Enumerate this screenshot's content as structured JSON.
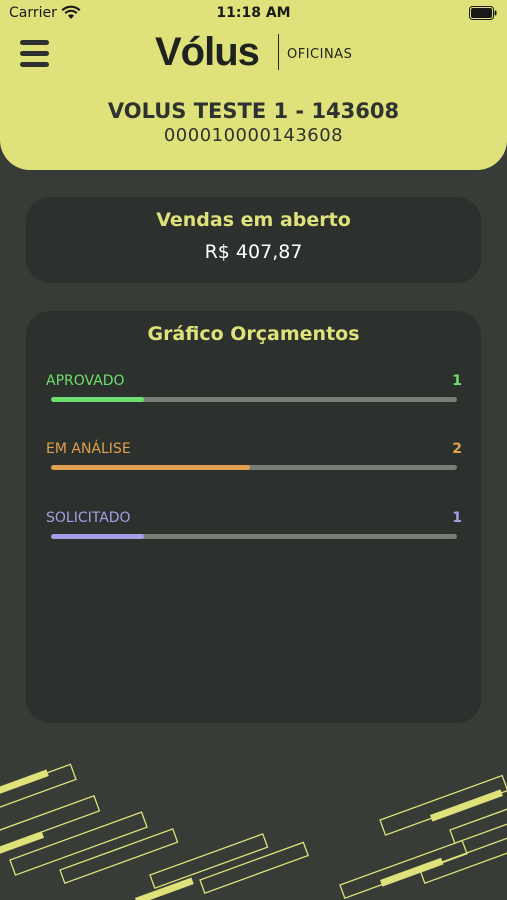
{
  "status_bar": {
    "carrier": "Carrier",
    "time": "11:18 AM"
  },
  "header": {
    "logo_text": "Vólus",
    "logo_subtext": "OFICINAS",
    "account_name": "VOLUS TESTE 1 - 143608",
    "account_number": "000010000143608"
  },
  "sales": {
    "title": "Vendas em aberto",
    "value": "R$ 407,87"
  },
  "chart": {
    "title": "Gráfico Orçamentos",
    "rows": [
      {
        "label": "APROVADO",
        "count": "1",
        "fraction": 0.23,
        "color": "#6ddf6e"
      },
      {
        "label": "EM ANÁLISE",
        "count": "2",
        "fraction": 0.49,
        "color": "#e0a050"
      },
      {
        "label": "SOLICITADO",
        "count": "1",
        "fraction": 0.23,
        "color": "#a59ee6"
      }
    ]
  },
  "colors": {
    "accent": "#dfe27a",
    "background": "#373c37",
    "card": "#2d312d"
  },
  "chart_data": {
    "type": "bar",
    "categories": [
      "APROVADO",
      "EM ANÁLISE",
      "SOLICITADO"
    ],
    "values": [
      1,
      2,
      1
    ],
    "title": "Gráfico Orçamentos"
  }
}
